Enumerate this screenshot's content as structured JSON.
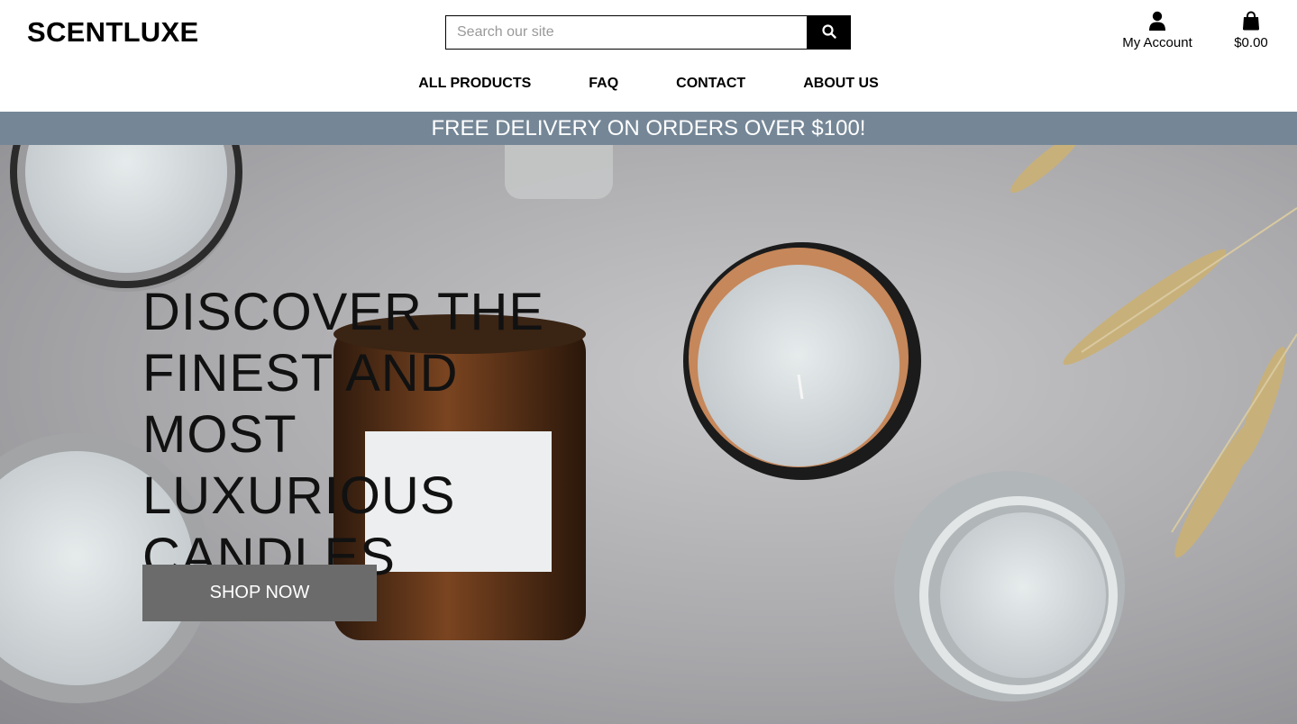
{
  "brand": {
    "logo": "SCENTLUXE"
  },
  "search": {
    "placeholder": "Search our site",
    "value": "",
    "icon": "search-icon"
  },
  "account": {
    "icon": "user-icon",
    "label": "My Account"
  },
  "cart": {
    "icon": "shopping-bag-icon",
    "total": "$0.00"
  },
  "nav": {
    "items": [
      {
        "label": "ALL PRODUCTS"
      },
      {
        "label": "FAQ"
      },
      {
        "label": "CONTACT"
      },
      {
        "label": "ABOUT US"
      }
    ]
  },
  "banner": {
    "text": "FREE DELIVERY ON ORDERS OVER $100!"
  },
  "hero": {
    "headline": "DISCOVER THE FINEST AND MOST LUXURIOUS CANDLES",
    "cta_label": "SHOP NOW"
  },
  "colors": {
    "banner": "#758797",
    "cta": "#6b6b6b",
    "text": "#000000"
  }
}
